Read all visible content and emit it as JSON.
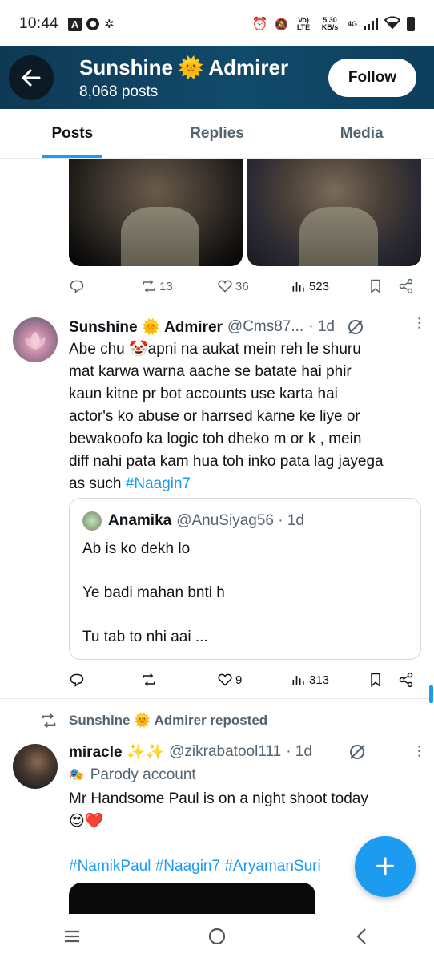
{
  "status_bar": {
    "time": "10:44",
    "volte": "Vo) LTE",
    "speed": "5.30 KB/s",
    "network": "4G"
  },
  "header": {
    "name_part1": "Sunshine",
    "name_emoji": "🌞",
    "name_part2": "Admirer",
    "post_count": "8,068 posts",
    "follow_label": "Follow",
    "back_icon": "arrow-left-icon"
  },
  "tabs": [
    {
      "label": "Posts",
      "active": true
    },
    {
      "label": "Replies",
      "active": false
    },
    {
      "label": "Media",
      "active": false
    }
  ],
  "post1_actions": {
    "reposts": "13",
    "likes": "36",
    "views": "523"
  },
  "post2": {
    "name_part1": "Sunshine",
    "name_emoji": "🌞",
    "name_part2": "Admirer",
    "handle": "@Cms87...",
    "time": "· 1d",
    "lines": [
      "Abe chu 🤡apni na aukat mein reh le shuru",
      "mat karwa warna aache se batate hai phir",
      "kaun kitne pr bot accounts use karta hai",
      "actor's ko abuse or harrsed karne ke liye or",
      "bewakoofo ka logic toh dheko m or k , mein",
      "diff nahi pata kam hua toh inko pata lag jayega"
    ],
    "last_line_text": "as such ",
    "hashtag": "#Naagin7",
    "quote": {
      "name": "Anamika",
      "handle": "@AnuSiyag56 · 1d",
      "line1": "Ab is ko dekh lo",
      "line2": "Ye badi mahan bnti h",
      "line3": "Tu tab to nhi aai ..."
    },
    "actions": {
      "reposts": "",
      "likes": "9",
      "views": "313"
    }
  },
  "repost_label": "Sunshine 🌞 Admirer reposted",
  "post3": {
    "name": "miracle ✨✨",
    "handle": "@zikrabatool111",
    "time": "· 1d",
    "parody": "Parody account",
    "line1": "Mr Handsome Paul is on a night shoot today",
    "line2": "😍❤️",
    "hashtags": "#NamikPaul #Naagin7 #AryamanSuri"
  },
  "fab_label": "+",
  "colors": {
    "accent": "#1d9bf0",
    "header_bg": "#114a6a",
    "muted": "#536471"
  }
}
